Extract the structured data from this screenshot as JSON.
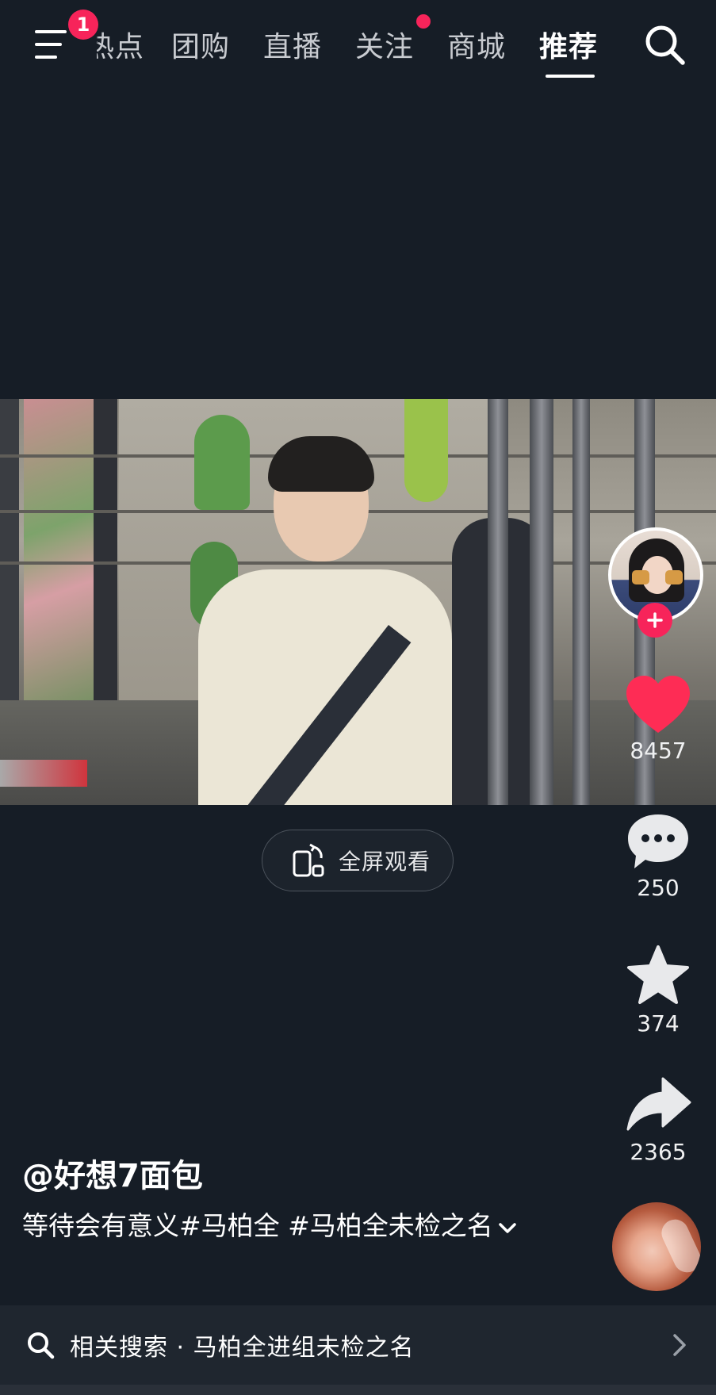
{
  "top_nav": {
    "menu_badge": "1",
    "tabs": [
      {
        "label": "热点"
      },
      {
        "label": "团购"
      },
      {
        "label": "直播"
      },
      {
        "label": "关注",
        "has_dot": true
      },
      {
        "label": "商城"
      },
      {
        "label": "推荐",
        "active": true
      }
    ],
    "search_icon": "search-icon",
    "accent_color": "#f7245a"
  },
  "player": {
    "fullscreen_label": "全屏观看"
  },
  "right_rail": {
    "like_count": "8457",
    "comment_count": "250",
    "favorite_count": "374",
    "share_count": "2365",
    "like_color": "#fe2c55"
  },
  "post": {
    "author": "@好想7面包",
    "caption": "等待会有意义#马柏全 #马柏全未检之名"
  },
  "related_search": {
    "text": "相关搜索 · 马柏全进组未检之名"
  }
}
